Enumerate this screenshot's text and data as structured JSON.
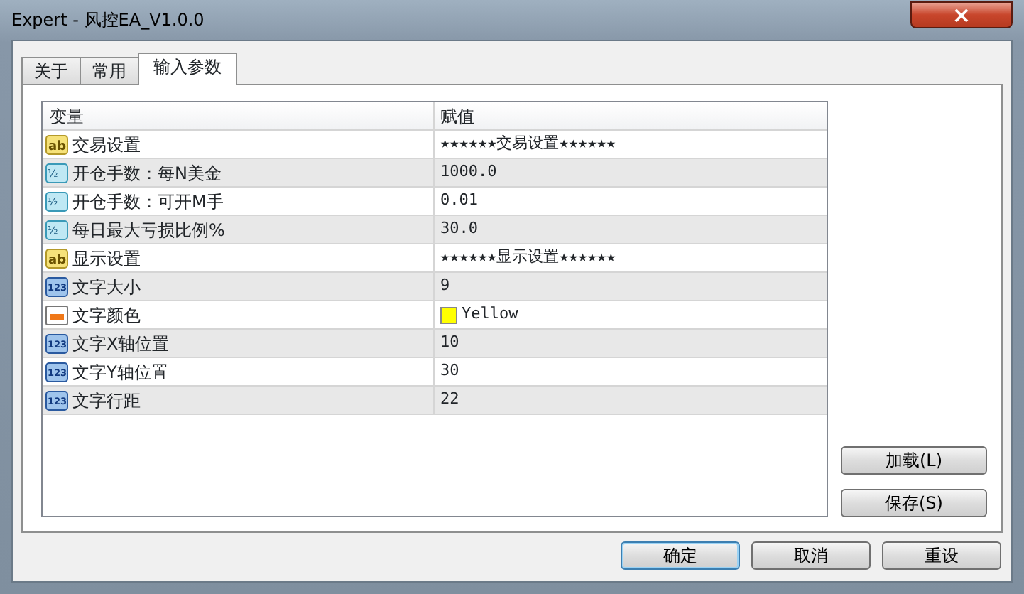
{
  "window": {
    "title": "Expert - 风控EA_V1.0.0",
    "close": "×"
  },
  "tabs": [
    {
      "label": "关于",
      "selected": false
    },
    {
      "label": "常用",
      "selected": false
    },
    {
      "label": "输入参数",
      "selected": true
    }
  ],
  "table": {
    "columns": [
      "变量",
      "赋值"
    ],
    "rows": [
      {
        "kind": "string",
        "icon_text": "ab",
        "name": "交易设置",
        "value": "★★★★★★交易设置★★★★★★"
      },
      {
        "kind": "double",
        "icon_text": "½",
        "name": "开仓手数：每N美金",
        "value": "1000.0"
      },
      {
        "kind": "double",
        "icon_text": "½",
        "name": "开仓手数：可开M手",
        "value": "0.01"
      },
      {
        "kind": "double",
        "icon_text": "½",
        "name": "每日最大亏损比例%",
        "value": "30.0"
      },
      {
        "kind": "string",
        "icon_text": "ab",
        "name": "显示设置",
        "value": "★★★★★★显示设置★★★★★★"
      },
      {
        "kind": "int",
        "icon_text": "123",
        "name": "文字大小",
        "value": "9"
      },
      {
        "kind": "color",
        "name": "文字颜色",
        "value": "Yellow",
        "color": "#ffff00"
      },
      {
        "kind": "int",
        "icon_text": "123",
        "name": "文字X轴位置",
        "value": "10"
      },
      {
        "kind": "int",
        "icon_text": "123",
        "name": "文字Y轴位置",
        "value": "30"
      },
      {
        "kind": "int",
        "icon_text": "123",
        "name": "文字行距",
        "value": "22"
      }
    ]
  },
  "side_buttons": [
    "加载(L)",
    "保存(S)"
  ],
  "buttons": [
    "确定",
    "取消",
    "重设"
  ]
}
